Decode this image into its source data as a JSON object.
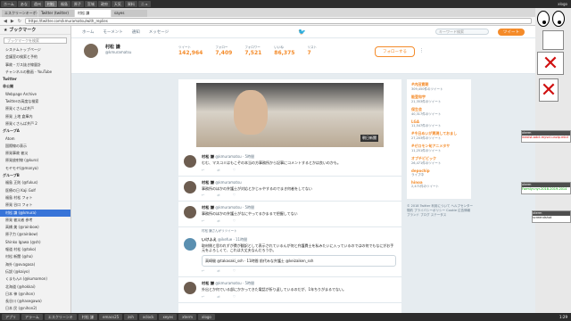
{
  "topbar": {
    "tabs": [
      "ホーム",
      "あな",
      "遠州",
      "村松",
      "福島",
      "原子",
      "宮城",
      "政府",
      "天気",
      "資料",
      "ニュ"
    ],
    "right": "xlogo"
  },
  "browser": {
    "tabs": [
      "エスクリーンキーボード",
      "Twitter (twitter)",
      "村松 謙",
      "sayes"
    ],
    "url": "https://twitter.com/kmuramatsu/with_replies",
    "back": "◀",
    "forward": "▶",
    "reload": "↻"
  },
  "sidebar": {
    "title": "ブックマーク",
    "search_placeholder": "ブックマークを検索",
    "items": [
      {
        "label": "システムトップページ",
        "folder": false
      },
      {
        "label": "会議室の検索と予約",
        "folder": false
      },
      {
        "label": "事故・ガス抜き線量計",
        "folder": false
      },
      {
        "label": "チャンネルの動画 - YouTube",
        "folder": false
      },
      {
        "label": "Twitter",
        "folder": true
      },
      {
        "label": "非公開",
        "folder": true
      },
      {
        "label": "Webpage Archive",
        "folder": false
      },
      {
        "label": "Twitterの高度な検索",
        "folder": false
      },
      {
        "label": "原発くさんば井戸",
        "folder": false
      },
      {
        "label": "原発 上地 倉庫内",
        "folder": false
      },
      {
        "label": "原発くさんば井戸 2",
        "folder": false
      },
      {
        "label": "グループA",
        "folder": true
      },
      {
        "label": "Atom",
        "folder": false
      },
      {
        "label": "国際線の表示",
        "folder": false
      },
      {
        "label": "原発事故 被災",
        "folder": false
      },
      {
        "label": "原発放射線 (@kuro)",
        "folder": false
      },
      {
        "label": "モヤモヤ(@monya)",
        "folder": false
      },
      {
        "label": "グループB",
        "folder": true
      },
      {
        "label": "福島 正則 (@fukus)",
        "folder": false
      },
      {
        "label": "医療の日 Kaji Golf",
        "folder": false
      },
      {
        "label": "福島 村松 フォト",
        "folder": false
      },
      {
        "label": "原発 谷口 フォト",
        "folder": false
      },
      {
        "label": "村松 謙 (@kmura)",
        "folder": false
      },
      {
        "label": "原発 被災者 参考",
        "folder": false
      },
      {
        "label": "高橋 美 (@rainbow)",
        "folder": false
      },
      {
        "label": "原子力 (@rainbow)",
        "folder": false
      },
      {
        "label": "Shinko Igawa (@sh)",
        "folder": false
      },
      {
        "label": "報道 村松 (@toko)",
        "folder": false
      },
      {
        "label": "村松 新聞 (@ho)",
        "folder": false
      },
      {
        "label": "海外 (@ovagasa)",
        "folder": false
      },
      {
        "label": "伝説 (@kaiyo)",
        "folder": false
      },
      {
        "label": "くまもんn (@kumamon)",
        "folder": false
      },
      {
        "label": "北海道 (@hokkai)",
        "folder": false
      },
      {
        "label": "日本 神 (@nihon)",
        "folder": false
      },
      {
        "label": "長谷川 (@hasegawa)",
        "folder": false
      },
      {
        "label": "日本 民 (@nihon2)",
        "folder": false
      }
    ]
  },
  "twitter": {
    "nav": [
      "ホーム",
      "モーメント",
      "通知",
      "メッセージ"
    ],
    "search_placeholder": "キーワード検索",
    "tweet_button": "ツイート",
    "profile": {
      "name": "村松 謙",
      "handle": "@kmuramatsu",
      "stats": [
        {
          "label": "ツイート",
          "value": "142,964"
        },
        {
          "label": "フォロー",
          "value": "7,409"
        },
        {
          "label": "フォロワー",
          "value": "7,521"
        },
        {
          "label": "いいね",
          "value": "86,375"
        },
        {
          "label": "リスト",
          "value": "7"
        }
      ],
      "follow_button": "フォローする"
    },
    "photo_sign": "朝日新聞",
    "tweets": [
      {
        "name": "村松 謙",
        "handle": "@kmuramatsu · 5時間",
        "text": "むむ、マスコミはもこぞの本当の方事務所から記事にコメントするとかは良いのかも。",
        "acts": [
          "↩",
          "⇄",
          "♡"
        ]
      },
      {
        "name": "村松 謙",
        "handle": "@kmuramatsu",
        "text": "事務所のほかの弁護士が対応とかじゃやするのでまき何者をしてない",
        "acts": [
          "↩",
          "⇄",
          "♡"
        ]
      },
      {
        "name": "村松 謙",
        "handle": "@kmuramatsu · 5時間",
        "text": "事務所のほかの弁護士がなにやってるかまるで把握してない",
        "acts": [
          "↩",
          "⇄",
          "♡"
        ]
      },
      {
        "name": "いけふえ",
        "handle": "@ikefue · 11時間",
        "text": "取材側と思われずが費が翻訳として表示されているんが何と弁護費士を私みたいに入っているのではの何でもなにがお手元をよろしくて、これは大丈夫なんだろうか。",
        "quote": "高崎駿 @takasaki_ssh · 11時間 前代みな弁護士 @keizaiken_ssh",
        "acts": [
          "↩",
          "⇄",
          "♡"
        ]
      },
      {
        "name": "村松 謙",
        "handle": "@kmuramatsu · 5時間",
        "text": "外出とか何でいる部にかかってきた電話が折り返しているのだが、1年ちりがまるでない。",
        "acts": [
          "↩",
          "⇄",
          "♡"
        ]
      }
    ],
    "retweet_note": "村松 謙さんがリツイート",
    "trends": [
      {
        "name": "#内田寛朝",
        "count": "309,450件のツイート"
      },
      {
        "name": "能登和宇",
        "count": "21,353件のツイート"
      },
      {
        "name": "保生会",
        "count": "40,317件のツイート"
      },
      {
        "name": "LGA",
        "count": "11,547件のツイート"
      },
      {
        "name": "#今日めいが実現しておまし",
        "count": "27,203件のツイート"
      },
      {
        "name": "#ゼロモン旬アニメタサ",
        "count": "11,251件のツイート"
      },
      {
        "name": "オプチビビック",
        "count": "26,471件のツイート"
      },
      {
        "name": "depochip",
        "count": "ライブ中"
      },
      {
        "name": "hinoa",
        "count": "2,471件のツイート"
      }
    ],
    "footer": "© 2018 Twitter 利用について ヘルプセンター 規約 プライバシーポリシー Cookie 広告情報 ブランド ブログ ステータス"
  },
  "desktop": {
    "terms": [
      {
        "title": "xterm",
        "line": "inexist-adct-myvcl-unzip.mkd"
      },
      {
        "title": "xterm",
        "line": "Formlyr-nyr-2018-2019-2014"
      },
      {
        "title": "xterm",
        "line": "screendshot"
      }
    ]
  },
  "taskbar": {
    "items": [
      "アプリ",
      "アラーム",
      "エスクリーンキ",
      "村松 謙",
      "emacs25",
      "zsh",
      "xclock",
      "xeyes",
      "xterm",
      "xlogo"
    ],
    "clock": "1:29"
  },
  "colors": {
    "accent": "#f48b2a",
    "twitter_blue": "#1da1f2",
    "selection": "#3874d8"
  }
}
